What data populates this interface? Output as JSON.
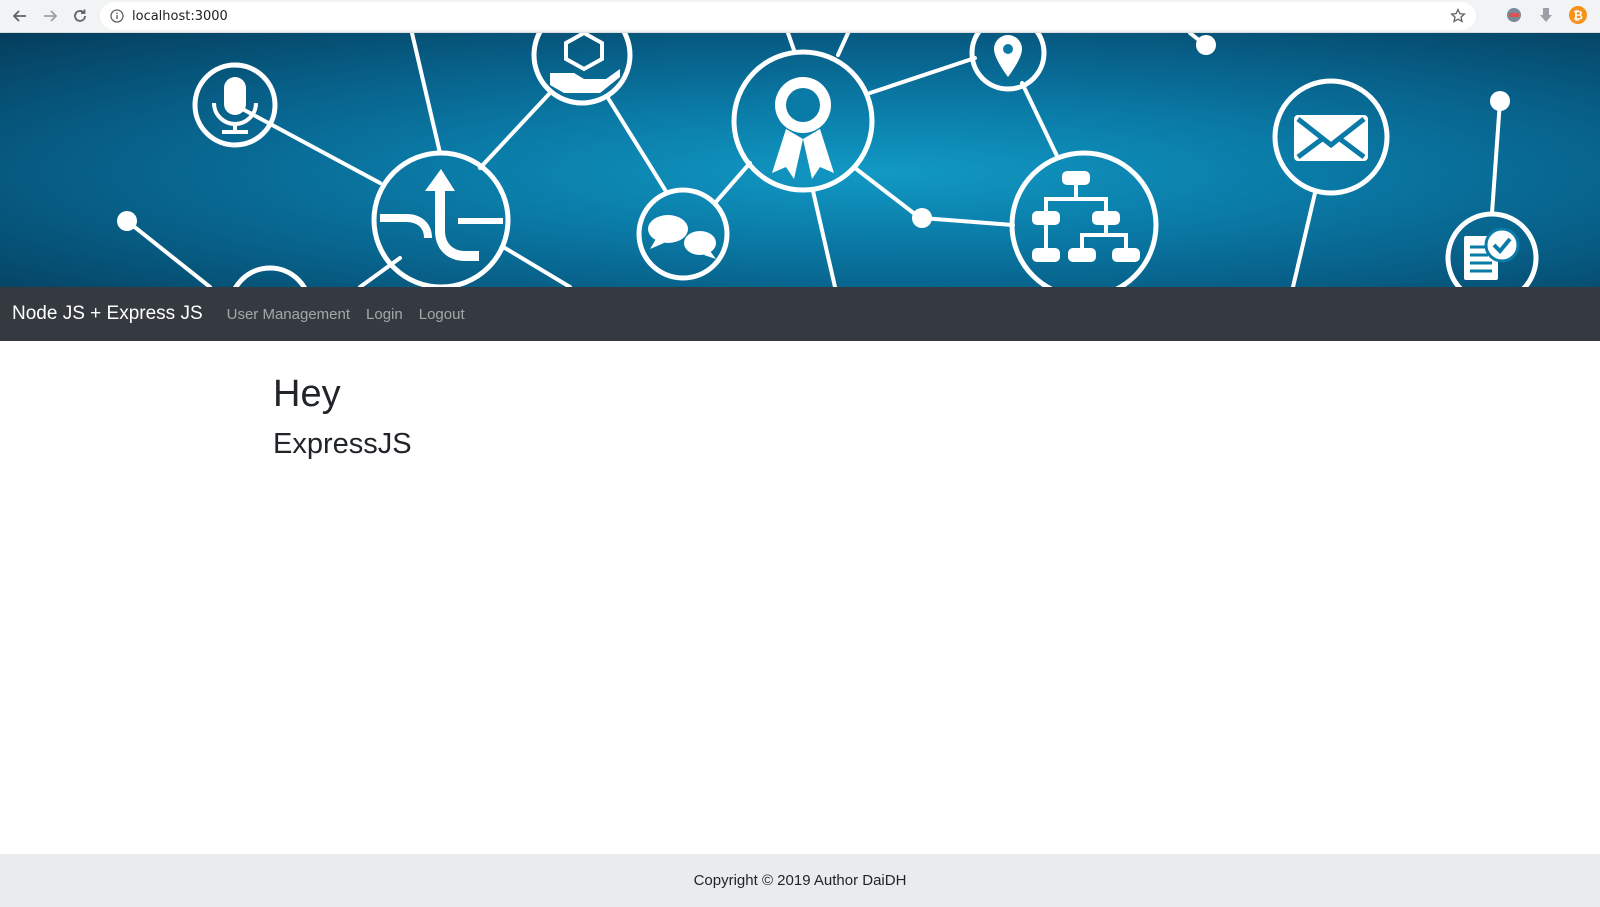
{
  "browser": {
    "url": "localhost:3000",
    "icons": [
      "back-arrow-icon",
      "forward-arrow-icon",
      "reload-icon",
      "info-icon",
      "star-icon",
      "extension-icon",
      "download-icon",
      "bitcoin-icon"
    ],
    "accent": "#f7931a"
  },
  "banner": {
    "background": "#0a7aa6",
    "icons": [
      "microphone-icon",
      "hand-box-icon",
      "route-arrow-icon",
      "chat-bubbles-icon",
      "award-ribbon-icon",
      "location-pin-icon",
      "org-chart-icon",
      "envelope-icon",
      "document-check-icon"
    ]
  },
  "navbar": {
    "brand": "Node JS + Express JS",
    "links": [
      {
        "label": "User Management"
      },
      {
        "label": "Login"
      },
      {
        "label": "Logout"
      }
    ],
    "background": "#343a40"
  },
  "main": {
    "heading": "Hey",
    "subheading": "ExpressJS"
  },
  "footer": {
    "text": "Copyright © 2019 Author DaiDH",
    "background": "#e9ecef"
  }
}
